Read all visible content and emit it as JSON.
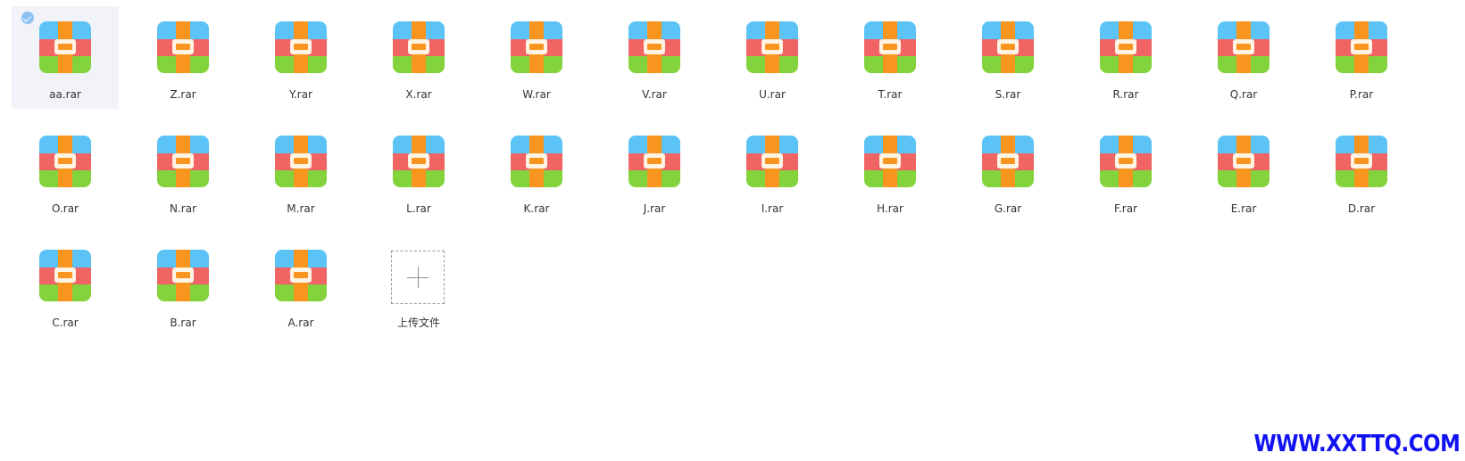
{
  "icon_name": "archive-rar-icon",
  "colors": {
    "icon_top": "#5bc3f5",
    "icon_middle": "#f06464",
    "icon_bottom": "#82d33c",
    "icon_strap": "#f7951f",
    "selection_bg": "#f1f3f8",
    "check_badge": "#8ec2f4",
    "watermark": "#1111f4"
  },
  "files": [
    {
      "name": "aa.rar",
      "selected": true
    },
    {
      "name": "Z.rar",
      "selected": false
    },
    {
      "name": "Y.rar",
      "selected": false
    },
    {
      "name": "X.rar",
      "selected": false
    },
    {
      "name": "W.rar",
      "selected": false
    },
    {
      "name": "V.rar",
      "selected": false
    },
    {
      "name": "U.rar",
      "selected": false
    },
    {
      "name": "T.rar",
      "selected": false
    },
    {
      "name": "S.rar",
      "selected": false
    },
    {
      "name": "R.rar",
      "selected": false
    },
    {
      "name": "Q.rar",
      "selected": false
    },
    {
      "name": "P.rar",
      "selected": false
    },
    {
      "name": "O.rar",
      "selected": false
    },
    {
      "name": "N.rar",
      "selected": false
    },
    {
      "name": "M.rar",
      "selected": false
    },
    {
      "name": "L.rar",
      "selected": false
    },
    {
      "name": "K.rar",
      "selected": false
    },
    {
      "name": "J.rar",
      "selected": false
    },
    {
      "name": "I.rar",
      "selected": false
    },
    {
      "name": "H.rar",
      "selected": false
    },
    {
      "name": "G.rar",
      "selected": false
    },
    {
      "name": "F.rar",
      "selected": false
    },
    {
      "name": "E.rar",
      "selected": false
    },
    {
      "name": "D.rar",
      "selected": false
    },
    {
      "name": "C.rar",
      "selected": false
    },
    {
      "name": "B.rar",
      "selected": false
    },
    {
      "name": "A.rar",
      "selected": false
    }
  ],
  "upload": {
    "label": "上传文件",
    "icon": "plus-icon"
  },
  "watermark": {
    "text": "WWW.XXTTQ.COM"
  }
}
